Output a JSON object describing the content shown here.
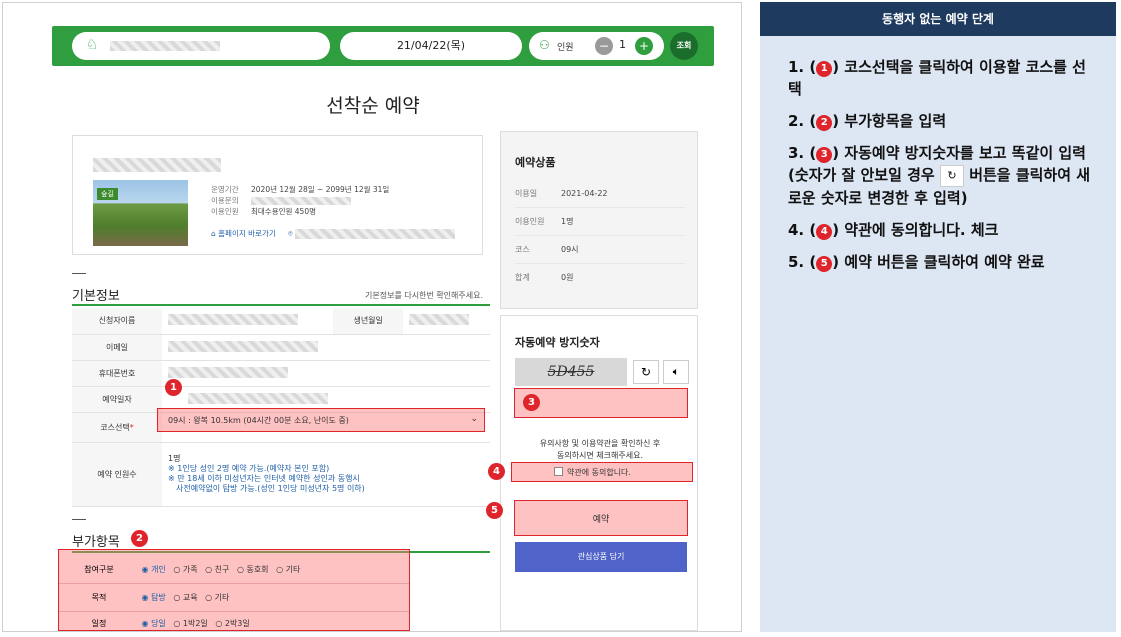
{
  "topbar": {
    "date": "21/04/22(목)",
    "people_label": "인원",
    "people_count": "1",
    "minus": "−",
    "plus": "+",
    "search_label": "조회"
  },
  "page_title": "선착순 예약",
  "card": {
    "tag": "숲길",
    "rows": [
      {
        "label": "운영기간",
        "value": "2020년 12월 28일 ~ 2099년 12월 31일"
      },
      {
        "label": "이용문의",
        "value": ""
      },
      {
        "label": "이용인원",
        "value": "최대수용인원 450명"
      }
    ],
    "homepage_link": "홈페이지 바로가기"
  },
  "side": {
    "title": "예약상품",
    "rows": [
      {
        "label": "이용일",
        "value": "2021-04-22"
      },
      {
        "label": "이용인원",
        "value": "1명"
      },
      {
        "label": "코스",
        "value": "09시"
      },
      {
        "label": "합계",
        "value": "0원"
      }
    ]
  },
  "basic": {
    "title": "기본정보",
    "note": "기본정보를 다시한번 확인해주세요.",
    "name_label": "신청자이름",
    "birth_label": "생년월일",
    "email_label": "이메일",
    "phone_label": "휴대폰번호",
    "date_label": "예약일자",
    "course_label": "코스선택",
    "course_value": "09시 : 왕복 10.5km (04시간 00분 소요, 난이도 중)",
    "headcount_label": "예약 인원수",
    "headcount_lines": [
      "1명",
      "※ 1인당 성인 2명 예약 가능.(예약자 본인 포함)",
      "※ 만 18세 이하 미성년자는 인터넷 예약한 성인과 동행시",
      "사전예약없이 탐방 가능.(성인 1인당 미성년자 5명 이하)"
    ]
  },
  "extra": {
    "title": "부가항목",
    "rows": [
      {
        "label": "참여구분",
        "options": [
          "◉ 개인",
          "○ 가족",
          "○ 친구",
          "○ 동호회",
          "○ 기타"
        ]
      },
      {
        "label": "목적",
        "options": [
          "◉ 탐방",
          "○ 교육",
          "○ 기타"
        ]
      },
      {
        "label": "일정",
        "options": [
          "◉ 당일",
          "○ 1박2일",
          "○ 2박3일"
        ]
      }
    ]
  },
  "captcha": {
    "title": "자동예약 방지숫자",
    "code": "5D455",
    "notice_line1": "유의사항 및 이용약관을 확인하신 후",
    "notice_line2": "동의하시면 체크해주세요.",
    "agree_label": "약관에 동의합니다.",
    "reserve_label": "예약",
    "wishlist_label": "관심상품 담기"
  },
  "badges": [
    "1",
    "2",
    "3",
    "4",
    "5"
  ],
  "panel": {
    "title": "동행자 없는 예약 단계",
    "steps": [
      {
        "num": "1. (",
        "badge": "1",
        "text": ") 코스선택을 클릭하여 이용할 코스를 선택"
      },
      {
        "num": "2. (",
        "badge": "2",
        "text": ") 부가항목을 입력"
      },
      {
        "num": "3. (",
        "badge": "3",
        "text1": ") 자동예약 방지숫자를 보고 똑같이 입력 (숫자가 잘 안보일 경우",
        "text2": "버튼을 클릭하여 새로운 숫자로 변경한 후 입력)"
      },
      {
        "num": "4. (",
        "badge": "4",
        "text": ") 약관에 동의합니다. 체크"
      },
      {
        "num": "5. (",
        "badge": "5",
        "text": ") 예약 버튼을 클릭하여 예약 완료"
      }
    ]
  },
  "colors": {
    "green": "#2e9e3e",
    "red": "#e0242b",
    "navy": "#1e3a5f",
    "blue_btn": "#4f63c8"
  }
}
